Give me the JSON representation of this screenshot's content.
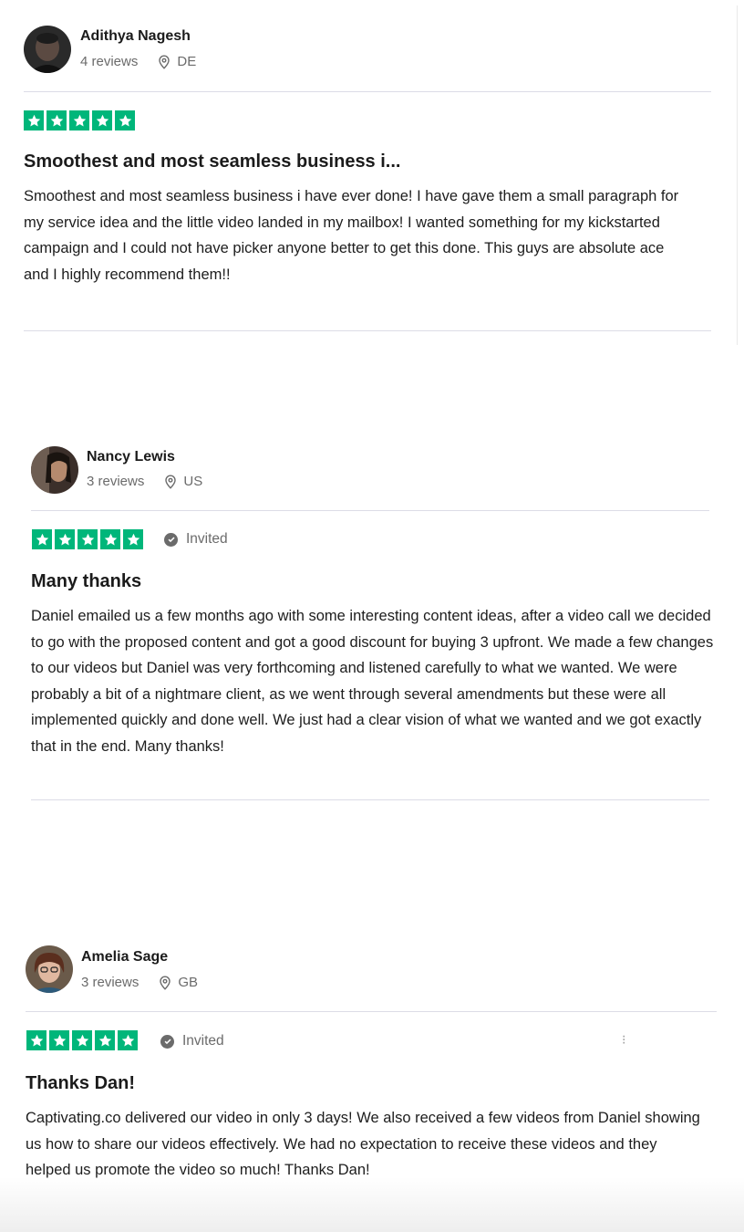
{
  "reviews": [
    {
      "author": "Adithya Nagesh",
      "review_count": "4 reviews",
      "country": "DE",
      "rating": 5,
      "invited_label": "",
      "title": "Smoothest and most seamless business i...",
      "body": "Smoothest and most seamless business i have ever done! I have gave them a small paragraph for my service idea and the little video landed in my mailbox! I wanted something for my kickstarted campaign and I could not have picker anyone better to get this done. This guys are absolute ace and I highly recommend them!!"
    },
    {
      "author": "Nancy Lewis",
      "review_count": "3 reviews",
      "country": "US",
      "rating": 5,
      "invited_label": "Invited",
      "title": "Many thanks",
      "body": "Daniel emailed us a few months ago with some interesting content ideas, after a video call we decided to go with the proposed content and got a good discount for buying 3 upfront. We made a few changes to our videos but Daniel was very forthcoming and listened carefully to what we wanted. We were probably a bit of a nightmare client, as we went through several amendments but these were all implemented quickly and done well. We just had a clear vision of what we wanted and we got exactly that in the end. Many thanks!"
    },
    {
      "author": "Amelia Sage",
      "review_count": "3 reviews",
      "country": "GB",
      "rating": 5,
      "invited_label": "Invited",
      "title": "Thanks Dan!",
      "body": "Captivating.co delivered our video in only 3 days! We also received a few videos from Daniel showing us how to share our videos effectively. We had no expectation to receive these videos and they helped us promote the video so much! Thanks Dan!"
    }
  ],
  "icons": {
    "star": "star-icon",
    "location": "location-pin-icon",
    "invited": "check-circle-icon",
    "more": "more-options-icon"
  },
  "colors": {
    "star_green": "#00b67a",
    "text_primary": "#191919",
    "text_secondary": "#6b6b6b",
    "divider": "#dcdce6"
  }
}
